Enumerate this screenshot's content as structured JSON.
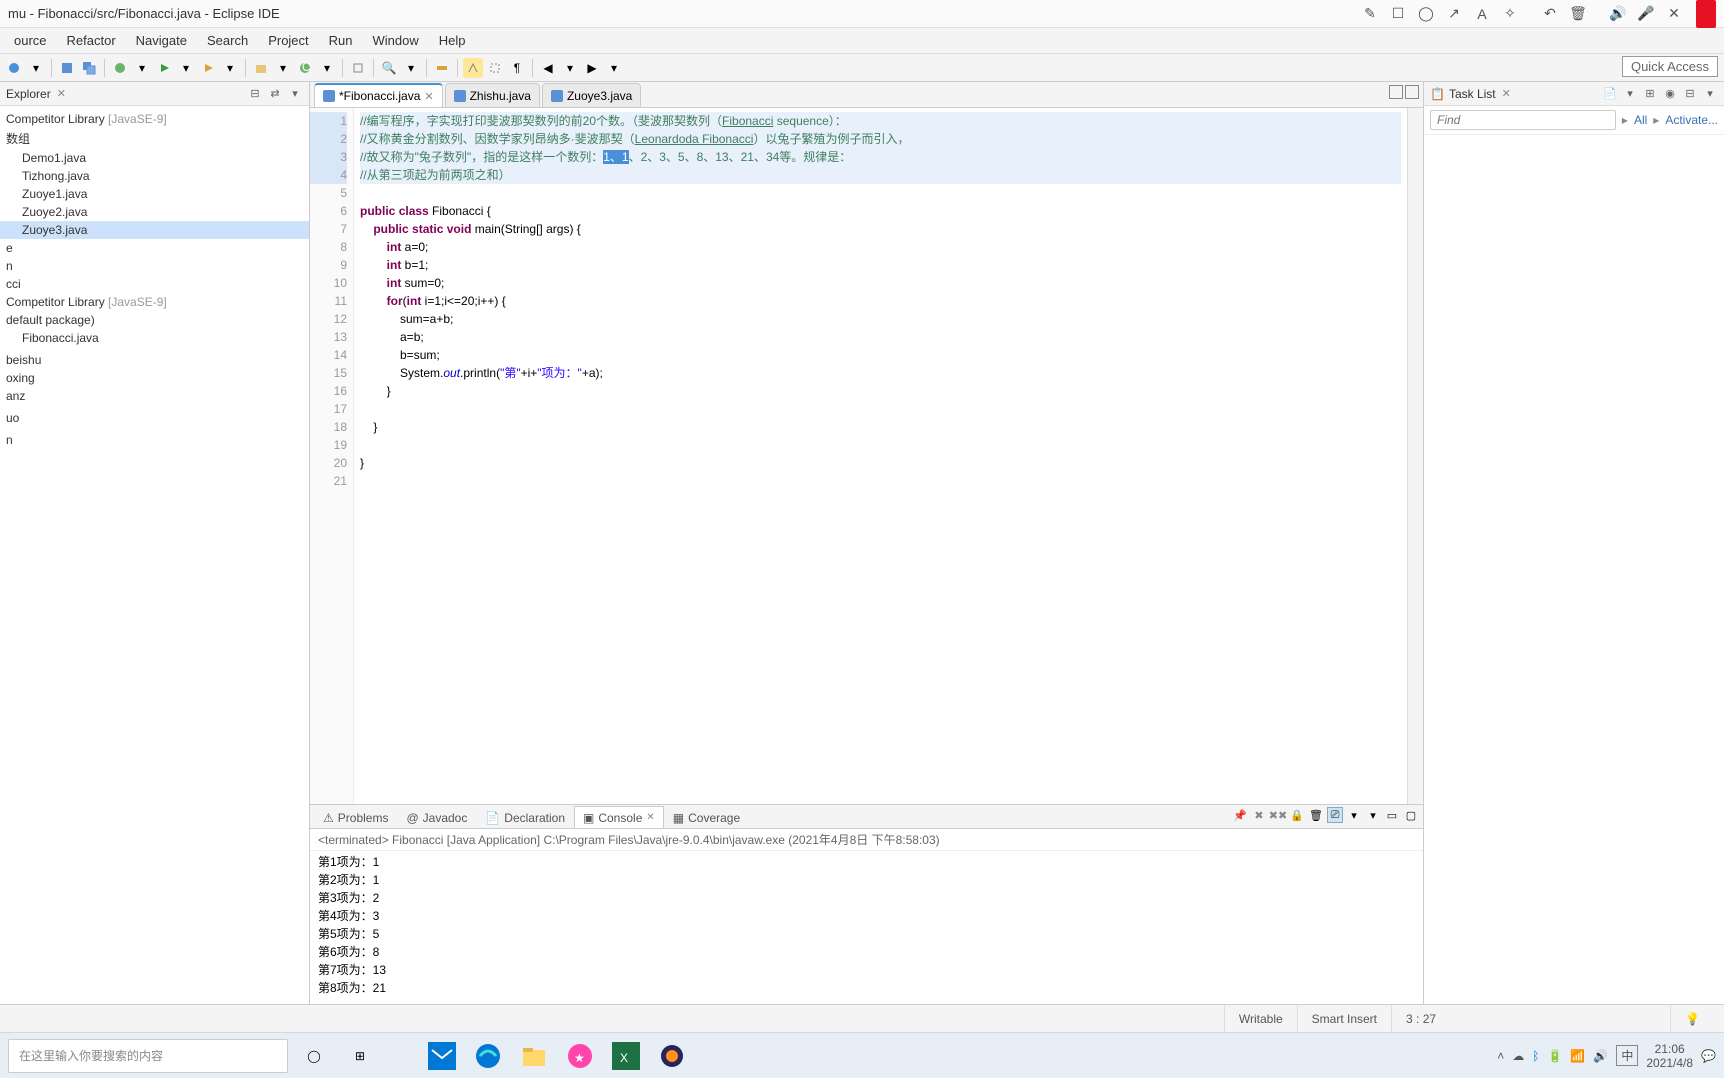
{
  "window": {
    "title": "mu - Fibonacci/src/Fibonacci.java - Eclipse IDE"
  },
  "titlebar_icons": [
    "edit",
    "square",
    "circle",
    "arrow",
    "text",
    "wand",
    "sep",
    "undo",
    "trash",
    "sep",
    "sound",
    "mic",
    "close"
  ],
  "menus": [
    "ource",
    "Refactor",
    "Navigate",
    "Search",
    "Project",
    "Run",
    "Window",
    "Help"
  ],
  "quick_access": "Quick Access",
  "explorer": {
    "title": "Explorer",
    "items": [
      {
        "label": "Competitor Library",
        "suffix": " [JavaSE-9]",
        "cls": "lib"
      },
      {
        "label": "数组"
      },
      {
        "label": "Demo1.java",
        "indent": 1
      },
      {
        "label": "Tizhong.java",
        "indent": 1
      },
      {
        "label": "Zuoye1.java",
        "indent": 1
      },
      {
        "label": "Zuoye2.java",
        "indent": 1
      },
      {
        "label": "Zuoye3.java",
        "indent": 1,
        "selected": true
      },
      {
        "label": "e"
      },
      {
        "label": "n"
      },
      {
        "label": "cci"
      },
      {
        "label": "Competitor Library",
        "suffix": " [JavaSE-9]",
        "cls": "lib"
      },
      {
        "label": "default package)"
      },
      {
        "label": "Fibonacci.java",
        "indent": 1
      },
      {
        "label": ""
      },
      {
        "label": "beishu"
      },
      {
        "label": "oxing"
      },
      {
        "label": "anz"
      },
      {
        "label": ""
      },
      {
        "label": "uo"
      },
      {
        "label": ""
      },
      {
        "label": "n"
      }
    ]
  },
  "tabs": [
    {
      "label": "*Fibonacci.java",
      "active": true
    },
    {
      "label": "Zhishu.java"
    },
    {
      "label": "Zuoye3.java"
    }
  ],
  "code": {
    "lines": [
      {
        "n": 1,
        "hl": true,
        "segs": [
          {
            "t": "//编写程序，字实现打印斐波那契数列的前20个数。（斐波那契数列（",
            "c": "cm"
          },
          {
            "t": "Fibonacci",
            "c": "lnk"
          },
          {
            "t": " sequence）：",
            "c": "cm"
          }
        ]
      },
      {
        "n": 2,
        "hl": true,
        "segs": [
          {
            "t": "//又称黄金分割数列、因数学家列昂纳多·斐波那契（",
            "c": "cm"
          },
          {
            "t": "Leonardoda Fibonacci",
            "c": "lnk"
          },
          {
            "t": "）以兔子繁殖为例子而引入，",
            "c": "cm"
          }
        ]
      },
      {
        "n": 3,
        "hl": true,
        "segs": [
          {
            "t": "//故又称为\"兔子数列\"，指的是这样一个数列：",
            "c": "cm"
          },
          {
            "t": "1、1",
            "c": "sel"
          },
          {
            "t": "、2、3、5、8、13、21、34等。规律是：",
            "c": "cm"
          }
        ]
      },
      {
        "n": 4,
        "hl": true,
        "segs": [
          {
            "t": "//从第三项起为前两项之和）",
            "c": "cm"
          }
        ]
      },
      {
        "n": 5,
        "segs": []
      },
      {
        "n": 6,
        "segs": [
          {
            "t": "public",
            "c": "kw"
          },
          {
            "t": " "
          },
          {
            "t": "class",
            "c": "kw"
          },
          {
            "t": " Fibonacci {"
          }
        ]
      },
      {
        "n": 7,
        "segs": [
          {
            "t": "    "
          },
          {
            "t": "public",
            "c": "kw"
          },
          {
            "t": " "
          },
          {
            "t": "static",
            "c": "kw"
          },
          {
            "t": " "
          },
          {
            "t": "void",
            "c": "kw"
          },
          {
            "t": " main(String[] args) {"
          }
        ]
      },
      {
        "n": 8,
        "segs": [
          {
            "t": "        "
          },
          {
            "t": "int",
            "c": "kw"
          },
          {
            "t": " a=0;"
          }
        ]
      },
      {
        "n": 9,
        "segs": [
          {
            "t": "        "
          },
          {
            "t": "int",
            "c": "kw"
          },
          {
            "t": " b=1;"
          }
        ]
      },
      {
        "n": 10,
        "segs": [
          {
            "t": "        "
          },
          {
            "t": "int",
            "c": "kw"
          },
          {
            "t": " sum=0;"
          }
        ]
      },
      {
        "n": 11,
        "segs": [
          {
            "t": "        "
          },
          {
            "t": "for",
            "c": "kw"
          },
          {
            "t": "("
          },
          {
            "t": "int",
            "c": "kw"
          },
          {
            "t": " i=1;i<=20;i++) {"
          }
        ]
      },
      {
        "n": 12,
        "segs": [
          {
            "t": "            sum=a+b;"
          }
        ]
      },
      {
        "n": 13,
        "segs": [
          {
            "t": "            a=b;"
          }
        ]
      },
      {
        "n": 14,
        "segs": [
          {
            "t": "            b=sum;"
          }
        ]
      },
      {
        "n": 15,
        "segs": [
          {
            "t": "            System."
          },
          {
            "t": "out",
            "c": "fld"
          },
          {
            "t": ".println("
          },
          {
            "t": "\"第\"",
            "c": "str"
          },
          {
            "t": "+i+"
          },
          {
            "t": "\"项为：\"",
            "c": "str"
          },
          {
            "t": "+a);"
          }
        ]
      },
      {
        "n": 16,
        "segs": [
          {
            "t": "        }"
          }
        ]
      },
      {
        "n": 17,
        "segs": []
      },
      {
        "n": 18,
        "segs": [
          {
            "t": "    }"
          }
        ]
      },
      {
        "n": 19,
        "segs": []
      },
      {
        "n": 20,
        "segs": [
          {
            "t": "}"
          }
        ]
      },
      {
        "n": 21,
        "segs": []
      }
    ]
  },
  "bottom_tabs": [
    {
      "label": "Problems"
    },
    {
      "label": "Javadoc"
    },
    {
      "label": "Declaration"
    },
    {
      "label": "Console",
      "active": true
    },
    {
      "label": "Coverage"
    }
  ],
  "console": {
    "header": "<terminated> Fibonacci [Java Application] C:\\Program Files\\Java\\jre-9.0.4\\bin\\javaw.exe (2021年4月8日 下午8:58:03)",
    "lines": [
      "第1项为：1",
      "第2项为：1",
      "第3项为：2",
      "第4项为：3",
      "第5项为：5",
      "第6项为：8",
      "第7项为：13",
      "第8项为：21"
    ]
  },
  "tasklist": {
    "title": "Task List",
    "find_placeholder": "Find",
    "all": "All",
    "activate": "Activate..."
  },
  "status": {
    "writable": "Writable",
    "insert": "Smart Insert",
    "pos": "3 : 27"
  },
  "taskbar": {
    "search_placeholder": "在这里输入你要搜索的内容",
    "time": "21:06",
    "date": "2021/4/8",
    "ime": "中"
  }
}
